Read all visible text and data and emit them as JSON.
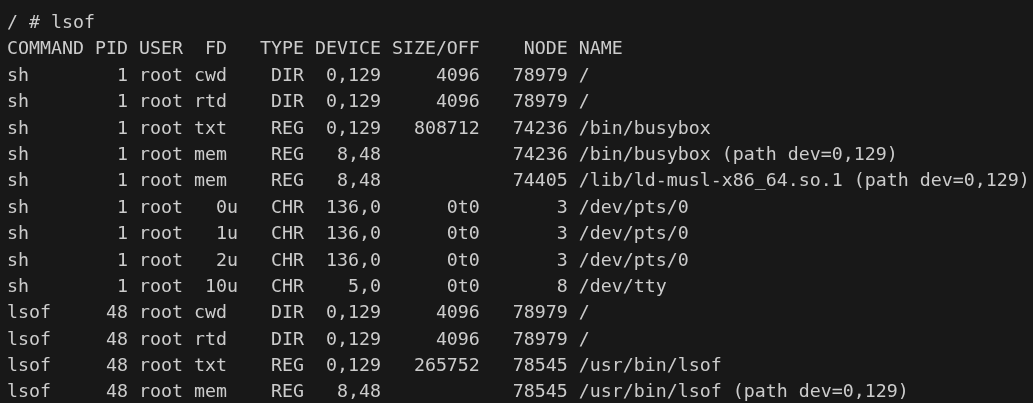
{
  "terminal": {
    "command_line": "/ # lsof",
    "output_lines": [
      "COMMAND PID USER  FD   TYPE DEVICE SIZE/OFF    NODE NAME",
      "sh        1 root cwd    DIR  0,129     4096   78979 /",
      "sh        1 root rtd    DIR  0,129     4096   78979 /",
      "sh        1 root txt    REG  0,129   808712   74236 /bin/busybox",
      "sh        1 root mem    REG   8,48            74236 /bin/busybox (path dev=0,129)",
      "sh        1 root mem    REG   8,48            74405 /lib/ld-musl-x86_64.so.1 (path dev=0,129)",
      "sh        1 root   0u   CHR  136,0      0t0       3 /dev/pts/0",
      "sh        1 root   1u   CHR  136,0      0t0       3 /dev/pts/0",
      "sh        1 root   2u   CHR  136,0      0t0       3 /dev/pts/0",
      "sh        1 root  10u   CHR    5,0      0t0       8 /dev/tty",
      "lsof     48 root cwd    DIR  0,129     4096   78979 /",
      "lsof     48 root rtd    DIR  0,129     4096   78979 /",
      "lsof     48 root txt    REG  0,129   265752   78545 /usr/bin/lsof",
      "lsof     48 root mem    REG   8,48            78545 /usr/bin/lsof (path dev=0,129)"
    ]
  }
}
